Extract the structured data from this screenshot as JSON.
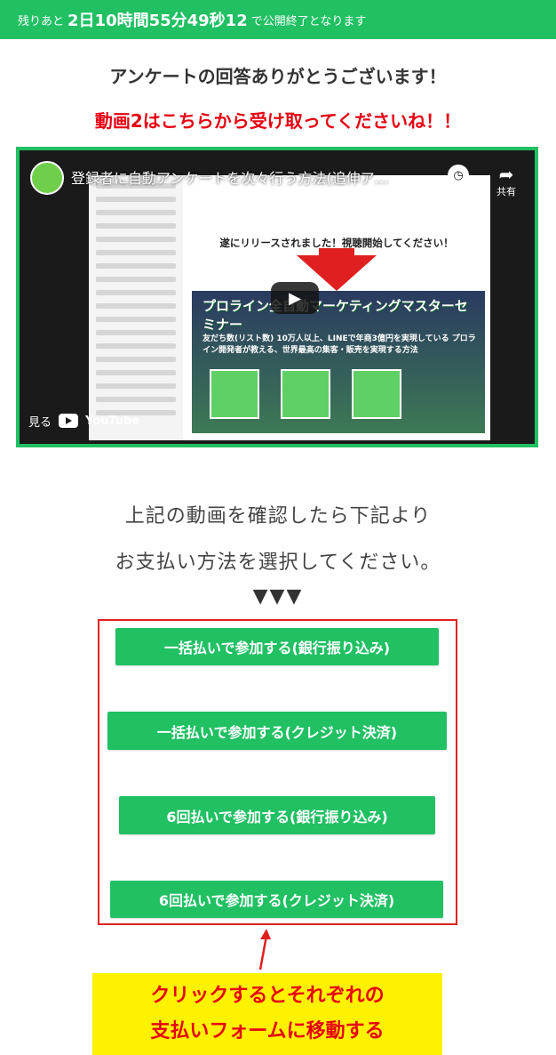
{
  "countdown": {
    "prefix": "残りあと",
    "time": "2日10時間55分49秒12",
    "suffix": "で公開終了となります"
  },
  "thanks_message": "アンケートの回答ありがとうございます！",
  "video_link_message": "動画2はこちらから受け取ってくださいね！！",
  "video": {
    "title": "登録者に自動アンケートを次々行う方法(追伸ア…",
    "watch_later_label": "後で見る",
    "share_label": "共有",
    "watch_on_label": "見る",
    "youtube_label": "YouTube",
    "release_text": "遂にリリースされました！視聴開始してください！",
    "banner_title": "プロライン全自動マーケティングマスターセミナー",
    "banner_sub": "友だち数(リスト数) 10万人以上、LINEで年商3億円を実現している プロライン開発者が教える、世界最高の集客・販売を実現する方法"
  },
  "confirm_text": {
    "line1": "上記の動画を確認したら下記より",
    "line2": "お支払い方法を選択してください。"
  },
  "arrows": "▼▼▼",
  "payment_buttons": [
    "一括払いで参加する(銀行振り込み)",
    "一括払いで参加する(クレジット決済)",
    "6回払いで参加する(銀行振り込み)",
    "6回払いで参加する(クレジット決済)"
  ],
  "annotation": {
    "line1": "クリックするとそれぞれの",
    "line2": "支払いフォームに移動する"
  },
  "colors": {
    "brand_green": "#20c063",
    "alert_red": "#e60012",
    "highlight_yellow": "#fff200"
  }
}
